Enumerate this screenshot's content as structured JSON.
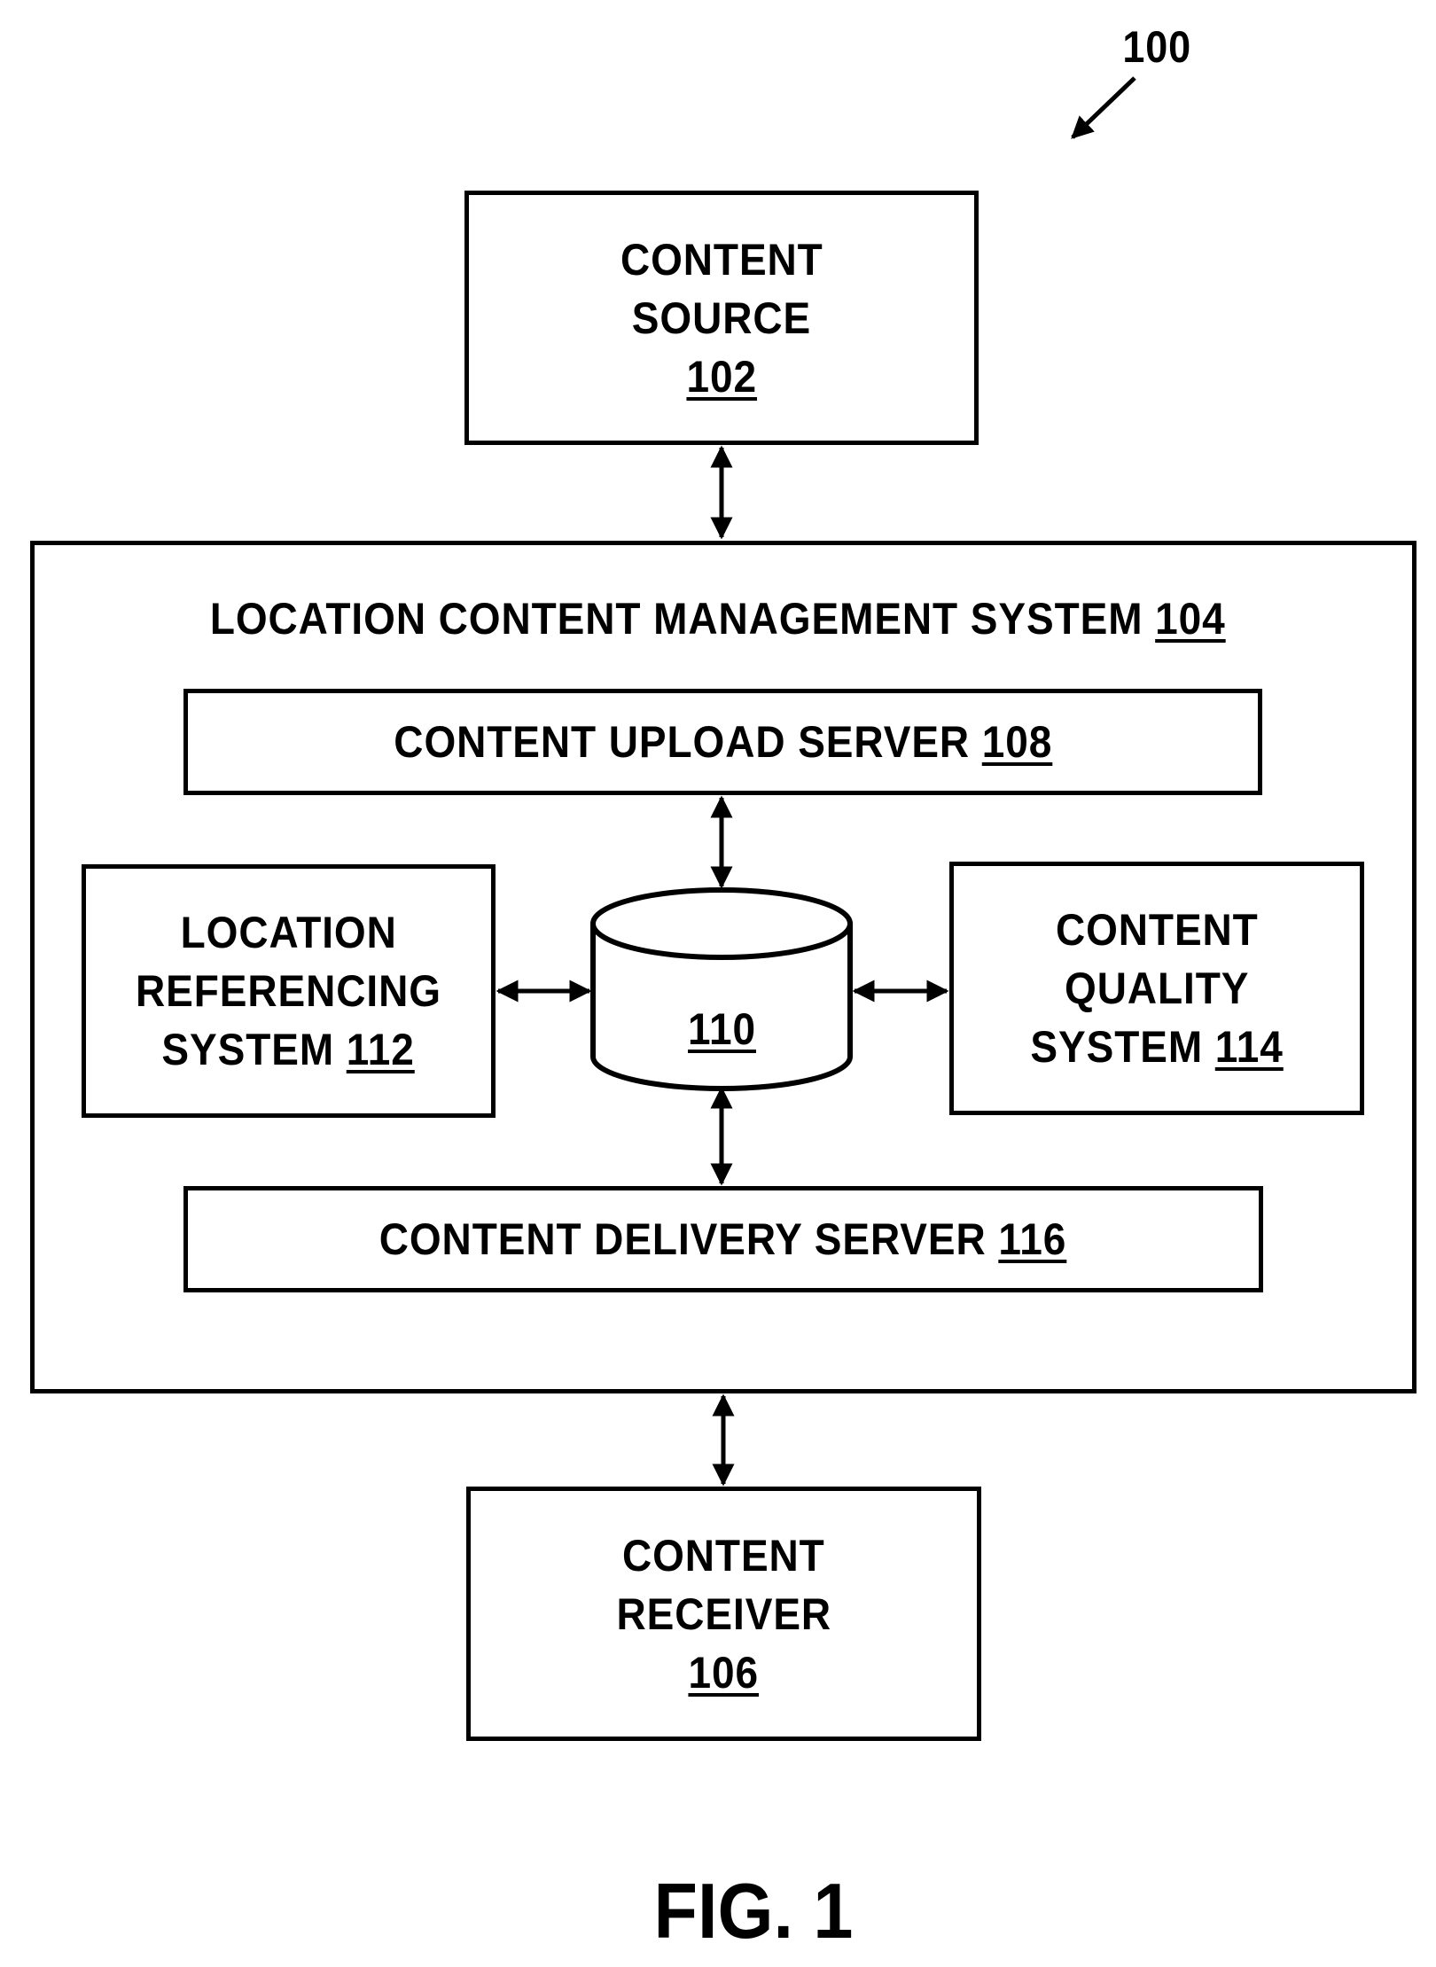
{
  "figure": {
    "number_label": "FIG. 1",
    "reference": "100"
  },
  "nodes": {
    "content_source": {
      "lines": [
        "CONTENT",
        "SOURCE"
      ],
      "ref": "102"
    },
    "lcms": {
      "title": "LOCATION CONTENT MANAGEMENT SYSTEM",
      "ref": "104"
    },
    "content_receiver": {
      "lines": [
        "CONTENT",
        "RECEIVER"
      ],
      "ref": "106"
    },
    "upload_server": {
      "title": "CONTENT UPLOAD SERVER",
      "ref": "108"
    },
    "database": {
      "ref": "110"
    },
    "location_referencing": {
      "lines": [
        "LOCATION",
        "REFERENCING",
        "SYSTEM"
      ],
      "ref": "112"
    },
    "content_quality": {
      "lines": [
        "CONTENT",
        "QUALITY",
        "SYSTEM"
      ],
      "ref": "114"
    },
    "delivery_server": {
      "title": "CONTENT DELIVERY SERVER",
      "ref": "116"
    }
  },
  "edges": [
    {
      "from": "content_source",
      "to": "lcms",
      "type": "bidirectional"
    },
    {
      "from": "upload_server",
      "to": "database",
      "type": "bidirectional"
    },
    {
      "from": "location_referencing",
      "to": "database",
      "type": "bidirectional"
    },
    {
      "from": "database",
      "to": "content_quality",
      "type": "bidirectional"
    },
    {
      "from": "database",
      "to": "delivery_server",
      "type": "bidirectional"
    },
    {
      "from": "lcms",
      "to": "content_receiver",
      "type": "bidirectional"
    }
  ]
}
